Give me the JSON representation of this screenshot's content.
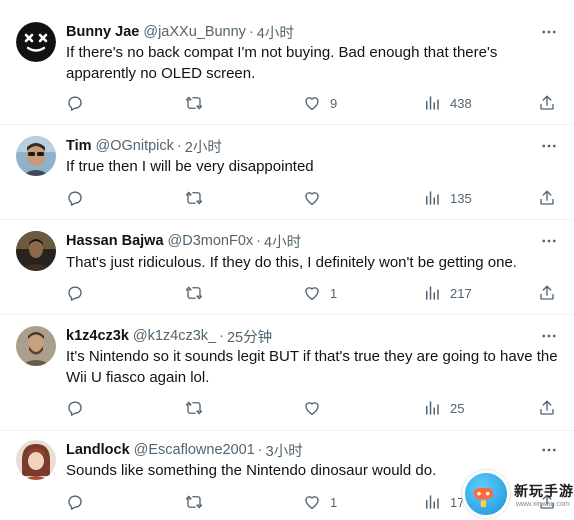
{
  "tweets": [
    {
      "name": "Bunny Jae",
      "handle": "@jaXXu_Bunny",
      "time": "4小时",
      "text": "If there's no back compat I'm not buying. Bad enough that there's apparently no OLED screen.",
      "likes": "9",
      "views": "438",
      "avatar": "x-eyes-face-avatar"
    },
    {
      "name": "Tim",
      "handle": "@OGnitpick",
      "time": "2小时",
      "text": "If true then I will be very disappointed",
      "likes": "",
      "views": "135",
      "avatar": "man-with-sunglasses-avatar"
    },
    {
      "name": "Hassan Bajwa",
      "handle": "@D3monF0x",
      "time": "4小时",
      "text": "That's just ridiculous. If they do this, I definitely won't be getting one.",
      "likes": "1",
      "views": "217",
      "avatar": "dark-portrait-avatar"
    },
    {
      "name": "k1z4cz3k",
      "handle": "@k1z4cz3k_",
      "time": "25分钟",
      "text": "It's Nintendo so it sounds legit BUT if that's true they are going to have the Wii U fiasco again lol.",
      "likes": "",
      "views": "25",
      "avatar": "bearded-character-avatar"
    },
    {
      "name": "Landlock",
      "handle": "@Escaflowne2001",
      "time": "3小时",
      "text": "Sounds like something the Nintendo dinosaur would do.",
      "likes": "1",
      "views": "176",
      "avatar": "anime-character-avatar"
    }
  ],
  "watermark": {
    "label": "新玩手游",
    "sub": "www.xinwan.com"
  },
  "colors": {
    "text": "#0f1419",
    "muted": "#536471",
    "divider": "#eff3f4"
  }
}
